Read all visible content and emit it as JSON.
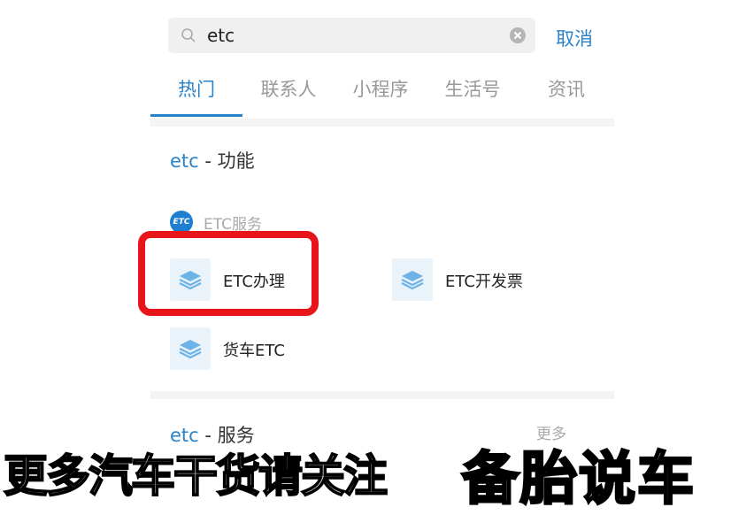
{
  "search": {
    "value": "etc",
    "cancel_label": "取消"
  },
  "tabs": [
    {
      "label": "热门"
    },
    {
      "label": "联系人"
    },
    {
      "label": "小程序"
    },
    {
      "label": "生活号"
    },
    {
      "label": "资讯"
    }
  ],
  "function_section": {
    "keyword": "etc",
    "title_suffix": " - 功能",
    "service_logo_text": "ETC",
    "service_label": "ETC服务",
    "items": [
      {
        "label": "ETC办理",
        "icon": "layers-icon"
      },
      {
        "label": "ETC开发票",
        "icon": "layers-icon"
      },
      {
        "label": "货车ETC",
        "icon": "layers-icon"
      }
    ]
  },
  "services_section": {
    "keyword": "etc",
    "title_suffix": " - 服务",
    "more_label": "更多"
  },
  "caption": {
    "text": "更多汽车干货请关注",
    "brand": "备胎说车"
  },
  "colors": {
    "accent": "#2a82c8",
    "highlight": "#e8151b"
  }
}
